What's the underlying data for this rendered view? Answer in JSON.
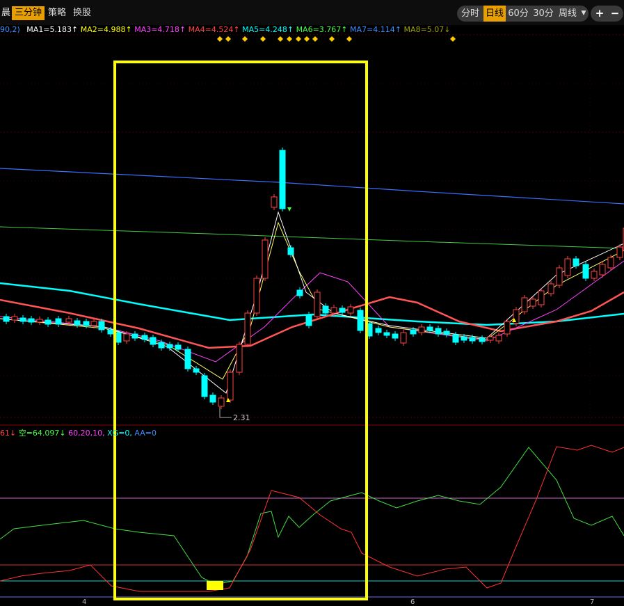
{
  "toolbar": {
    "tabs": [
      {
        "label": "晨",
        "active": false
      },
      {
        "label": "三分钟",
        "active": true
      },
      {
        "label": "策略",
        "active": false
      },
      {
        "label": "换股",
        "active": false
      }
    ],
    "periods": [
      {
        "label": "分时",
        "active": false
      },
      {
        "label": "日线",
        "active": true
      },
      {
        "label": "60分",
        "active": false
      },
      {
        "label": "30分",
        "active": false
      },
      {
        "label": "周线",
        "active": false
      }
    ],
    "zoom_in": "+",
    "zoom_out": "−"
  },
  "ma_legend": [
    {
      "text": "90,2)",
      "color": "#3a8fff"
    },
    {
      "text": "MA1=5.183↑",
      "color": "#ffffff"
    },
    {
      "text": "MA2=4.988↑",
      "color": "#ffff00"
    },
    {
      "text": "MA3=4.718↑",
      "color": "#ff44ff"
    },
    {
      "text": "MA4=4.524↑",
      "color": "#ff4444"
    },
    {
      "text": "MA5=4.248↑",
      "color": "#00ffff"
    },
    {
      "text": "MA6=3.767↑",
      "color": "#44ff44"
    },
    {
      "text": "MA7=4.114↑",
      "color": "#3a8fff"
    },
    {
      "text": "MA8=5.07↓",
      "color": "#a0a000"
    }
  ],
  "indicator_legend": [
    {
      "text": "61↓",
      "color": "#ff4444"
    },
    {
      "text": "空=64.097↓",
      "color": "#44ff44"
    },
    {
      "text": "60,20,10,",
      "color": "#ff44ff"
    },
    {
      "text": "XG=0,",
      "color": "#00ffff"
    },
    {
      "text": "AA=0",
      "color": "#3a8fff"
    }
  ],
  "low_price_label": "2.31",
  "x_axis_labels": [
    "4",
    "6",
    "7"
  ],
  "colors": {
    "up": "#ff4444",
    "down": "#00ffff",
    "highlight_box": "#ffff00",
    "signal_marker": "#ffcc00"
  }
}
